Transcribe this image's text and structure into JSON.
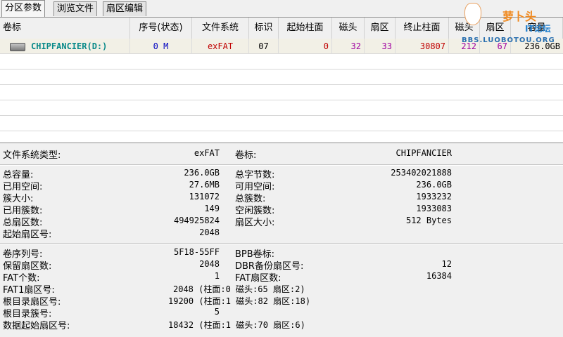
{
  "tabs": [
    "分区参数",
    "浏览文件",
    "扇区编辑"
  ],
  "table": {
    "headers": [
      "卷标",
      "序号(状态)",
      "文件系统",
      "标识",
      "起始柱面",
      "磁头",
      "扇区",
      "终止柱面",
      "磁头",
      "扇区",
      "容量"
    ],
    "row": {
      "volume": "CHIPFANCIER(D:)",
      "index": "0 M",
      "fs": "exFAT",
      "id": "07",
      "start_cyl": "0",
      "head1": "32",
      "sector1": "33",
      "end_cyl": "30807",
      "head2": "212",
      "sector2": "67",
      "capacity": "236.0GB"
    }
  },
  "watermark": {
    "title": "萝卜头",
    "sub": "IT论坛",
    "url": "BBS.LUOBOTOU.ORG"
  },
  "fsinfo": {
    "fs_type_label": "文件系统类型:",
    "fs_type_value": "exFAT",
    "volume_label": "卷标:",
    "volume_value": "CHIPFANCIER"
  },
  "left_stats": [
    {
      "label": "总容量:",
      "value": "236.0GB"
    },
    {
      "label": "已用空间:",
      "value": "27.6MB"
    },
    {
      "label": "簇大小:",
      "value": "131072"
    },
    {
      "label": "已用簇数:",
      "value": "149"
    },
    {
      "label": "总扇区数:",
      "value": "494925824"
    },
    {
      "label": "起始扇区号:",
      "value": "2048"
    }
  ],
  "right_stats": [
    {
      "label": "总字节数:",
      "value": "253402021888"
    },
    {
      "label": "可用空间:",
      "value": "236.0GB"
    },
    {
      "label": "总簇数:",
      "value": "1933232"
    },
    {
      "label": "空闲簇数:",
      "value": "1933083"
    },
    {
      "label": "扇区大小:",
      "value": "512 Bytes"
    }
  ],
  "bpb_left": [
    {
      "label": "卷序列号:",
      "value": "5F18-55FF"
    },
    {
      "label": "保留扇区数:",
      "value": "2048"
    },
    {
      "label": "FAT个数:",
      "value": "1"
    },
    {
      "label": "FAT1扇区号:",
      "value": "2048 (柱面:0 磁头:65 扇区:2)"
    },
    {
      "label": "根目录扇区号:",
      "value": "19200 (柱面:1 磁头:82 扇区:18)"
    },
    {
      "label": "根目录簇号:",
      "value": "5"
    },
    {
      "label": "数据起始扇区号:",
      "value": "18432 (柱面:1 磁头:70 扇区:6)"
    }
  ],
  "bpb_right": [
    {
      "label": "BPB卷标:",
      "value": ""
    },
    {
      "label": "DBR备份扇区号:",
      "value": "12"
    },
    {
      "label": "FAT扇区数:",
      "value": "16384"
    }
  ]
}
